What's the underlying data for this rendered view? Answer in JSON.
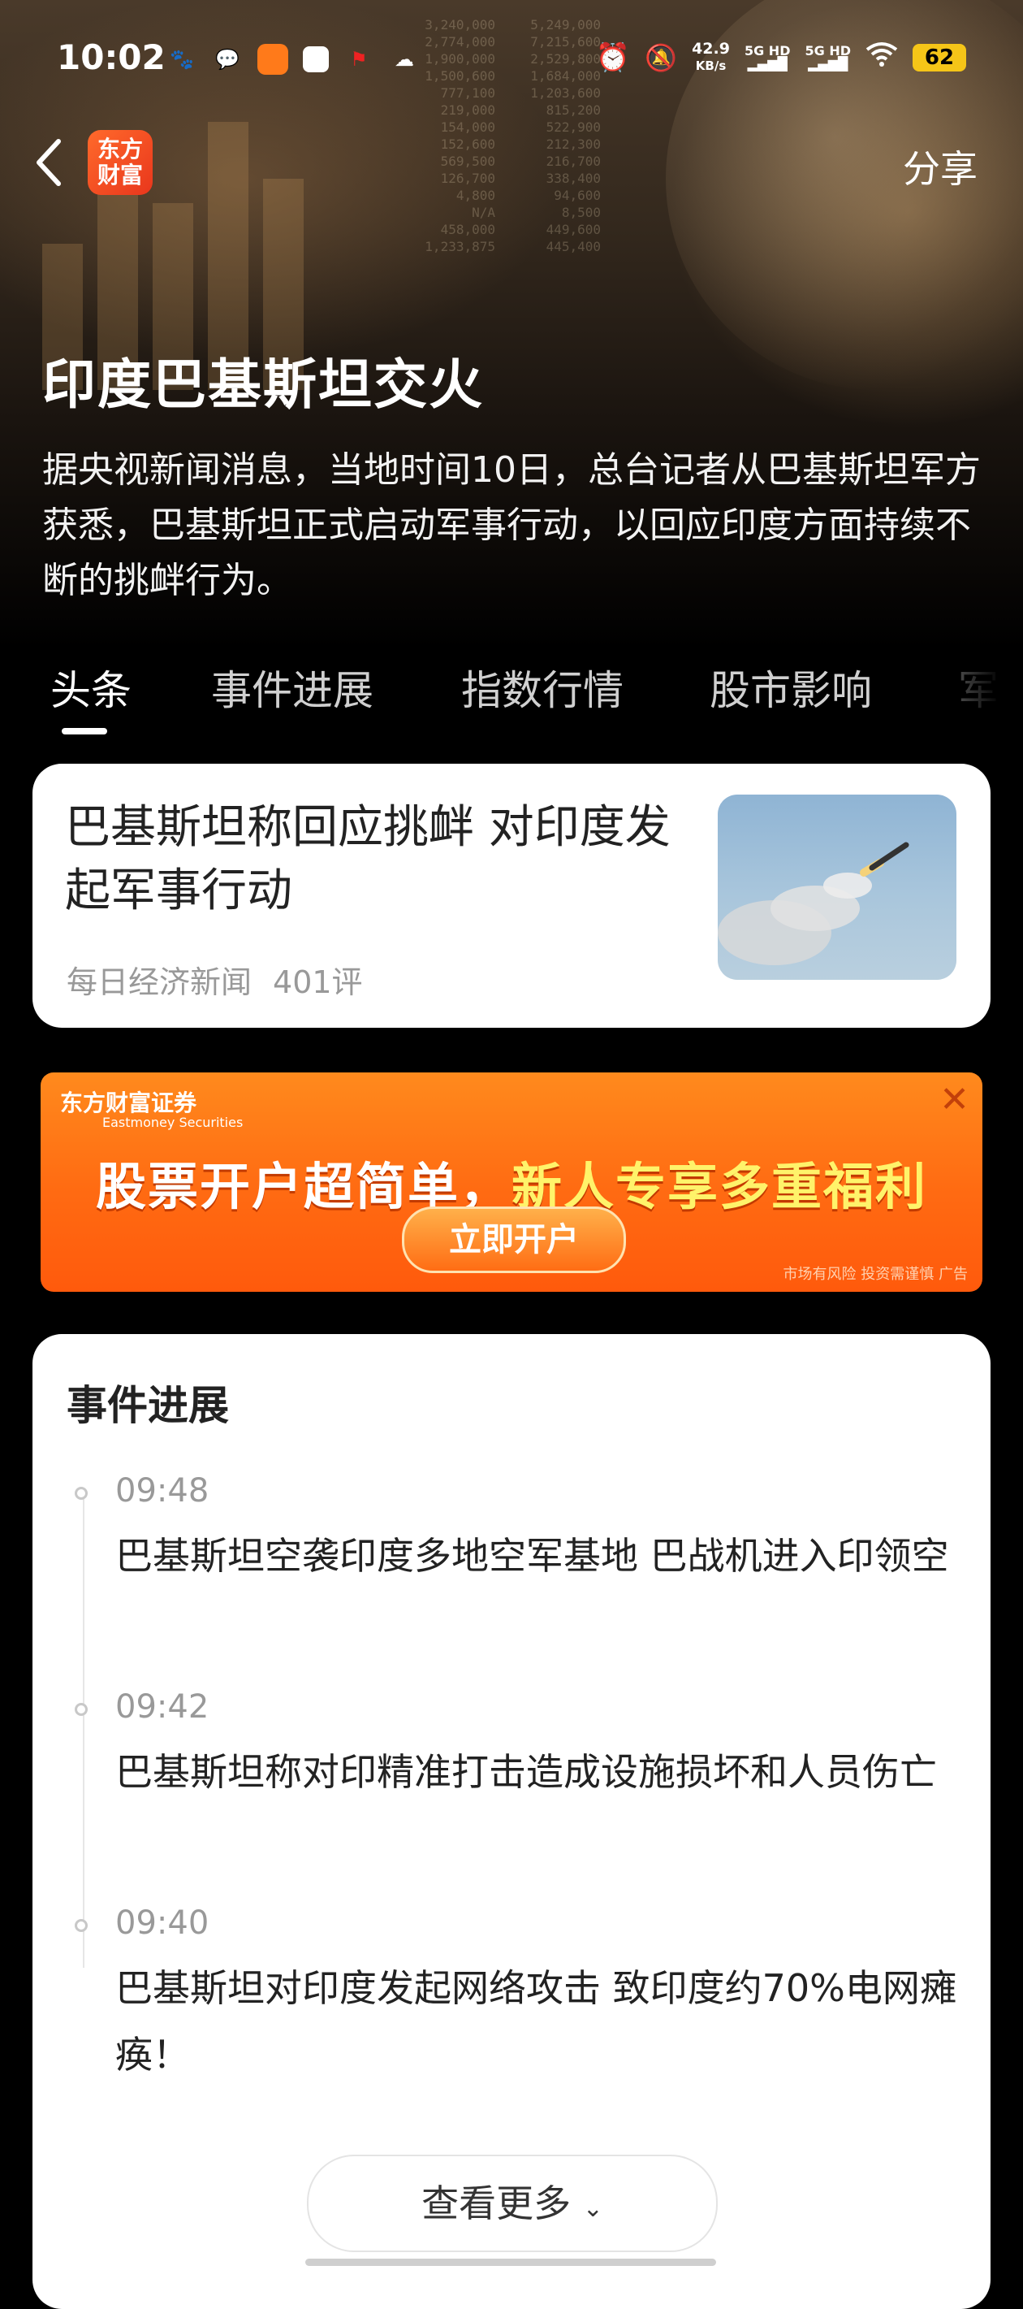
{
  "status_bar": {
    "time": "10:02",
    "net_speed_value": "42.9",
    "net_speed_unit": "KB/s",
    "signal_1": "5G HD",
    "signal_2": "5G HD",
    "battery": "62"
  },
  "header": {
    "logo_text": "东方财富",
    "share_label": "分享"
  },
  "topic": {
    "title": "印度巴基斯坦交火",
    "description": "据央视新闻消息，当地时间10日，总台记者从巴基斯坦军方获悉，巴基斯坦正式启动军事行动，以回应印度方面持续不断的挑衅行为。"
  },
  "tabs": [
    {
      "label": "头条",
      "active": true
    },
    {
      "label": "事件进展",
      "active": false
    },
    {
      "label": "指数行情",
      "active": false
    },
    {
      "label": "股市影响",
      "active": false
    },
    {
      "label": "军工",
      "active": false
    }
  ],
  "headline_card": {
    "title": "巴基斯坦称回应挑衅 对印度发起军事行动",
    "source": "每日经济新闻",
    "comments": "401评"
  },
  "ad": {
    "brand": "东方财富证券",
    "brand_en": "Eastmoney Securities",
    "slogan_part1": "股票开户超简单，",
    "slogan_part2": "新人专享多重福利",
    "button": "立即开户",
    "disclaimer": "市场有风险 投资需谨慎 广告"
  },
  "timeline": {
    "title": "事件进展",
    "items": [
      {
        "time": "09:48",
        "text": "巴基斯坦空袭印度多地空军基地 巴战机进入印领空"
      },
      {
        "time": "09:42",
        "text": "巴基斯坦称对印精准打击造成设施损坏和人员伤亡"
      },
      {
        "time": "09:40",
        "text": "巴基斯坦对印度发起网络攻击 致印度约70%电网瘫痪！"
      }
    ],
    "more_label": "查看更多"
  }
}
